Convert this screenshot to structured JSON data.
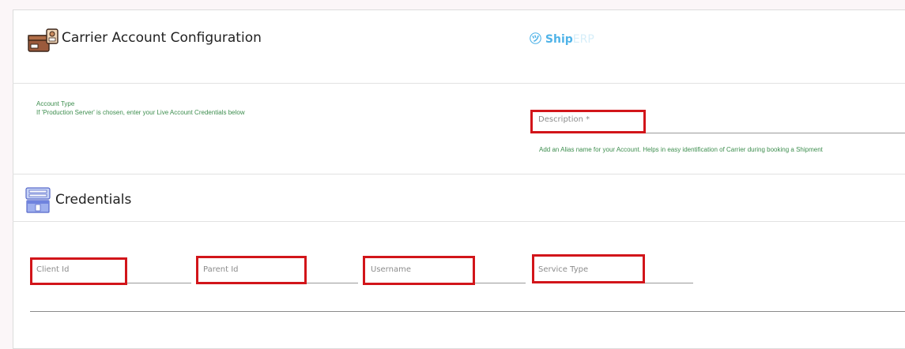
{
  "header": {
    "title": "Carrier Account Configuration",
    "icon": "carrier-box-icon",
    "logo_text": "Ship",
    "logo_faded": "ERP"
  },
  "account": {
    "type_label": "Account Type",
    "type_help": "If 'Production Server' is chosen, enter your Live Account Credentials below",
    "description_placeholder": "Description *",
    "description_help": "Add an Alias name for your Account. Helps in easy identification of Carrier during booking a Shipment"
  },
  "credentials": {
    "title": "Credentials",
    "icon": "credentials-icon",
    "fields": [
      {
        "label": "Client Id"
      },
      {
        "label": "Parent Id"
      },
      {
        "label": "Username"
      },
      {
        "label": "Service Type"
      }
    ]
  },
  "colors": {
    "accent_green": "#3e8e4f",
    "highlight_red": "#d2151a",
    "logo_blue": "#4fb3e8"
  }
}
